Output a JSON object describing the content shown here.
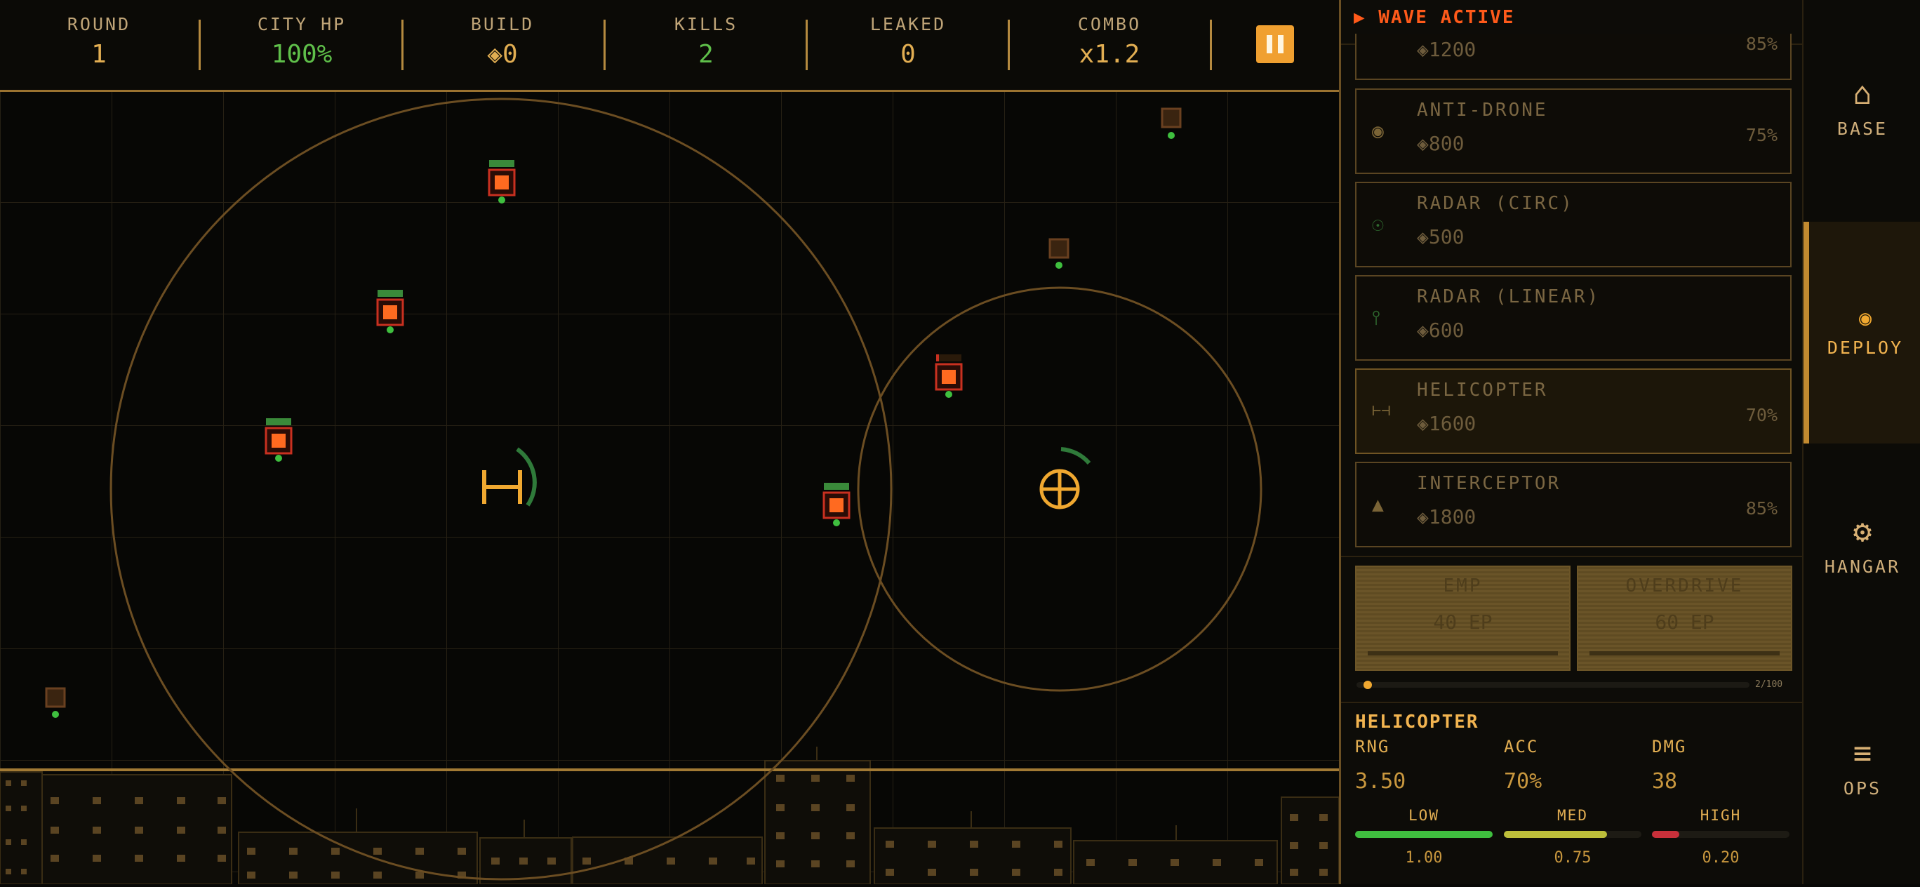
{
  "hud": {
    "stats": [
      {
        "label": "ROUND",
        "value": "1",
        "color": "#e2ae52"
      },
      {
        "label": "CITY HP",
        "value": "100%",
        "color": "#5fbf4a"
      },
      {
        "label": "BUILD",
        "value": "◈0",
        "color": "#e2ae52"
      },
      {
        "label": "KILLS",
        "value": "2",
        "color": "#5fbf4a"
      },
      {
        "label": "LEAKED",
        "value": "0",
        "color": "#e2ae52"
      },
      {
        "label": "COMBO",
        "value": "x1.2",
        "color": "#e2ae52"
      }
    ],
    "pause_icon": "pause-icon"
  },
  "panel": {
    "status": "▶ WAVE ACTIVE",
    "partial_card": {
      "cost": "◈1200",
      "pct": "85%"
    },
    "cards": [
      {
        "icon": "◉",
        "icon_name": "anti-drone-icon",
        "name": "ANTI-DRONE",
        "cost": "◈800",
        "pct": "75%"
      },
      {
        "icon": "☉",
        "icon_name": "radar-circular-icon",
        "name": "RADAR (CIRC)",
        "cost": "◈500",
        "pct": ""
      },
      {
        "icon": "⫯",
        "icon_name": "radar-linear-icon",
        "name": "RADAR (LINEAR)",
        "cost": "◈600",
        "pct": ""
      },
      {
        "icon": "⊢⊣",
        "icon_name": "helicopter-icon",
        "name": "HELICOPTER",
        "cost": "◈1600",
        "pct": "70%"
      },
      {
        "icon": "▲",
        "icon_name": "interceptor-icon",
        "name": "INTERCEPTOR",
        "cost": "◈1800",
        "pct": "85%"
      }
    ],
    "abilities": [
      {
        "name": "EMP",
        "cost": "40 EP"
      },
      {
        "name": "OVERDRIVE",
        "cost": "60 EP"
      }
    ],
    "energy": {
      "label": "2/100",
      "fraction": 0.02
    },
    "selected": {
      "title": "HELICOPTER",
      "rng_label": "RNG",
      "rng": "3.50",
      "acc_label": "ACC",
      "acc": "70%",
      "dmg_label": "DMG",
      "dmg": "38",
      "eff": [
        {
          "label": "LOW",
          "value": "1.00",
          "fraction": 1.0,
          "color": "#3fbf3f"
        },
        {
          "label": "MED",
          "value": "0.75",
          "fraction": 0.75,
          "color": "#bdbf3a"
        },
        {
          "label": "HIGH",
          "value": "0.20",
          "fraction": 0.2,
          "color": "#c8303a"
        }
      ]
    }
  },
  "nav": [
    {
      "icon": "⌂",
      "icon_name": "home-icon",
      "label": "BASE",
      "active": false
    },
    {
      "icon": "◉",
      "icon_name": "deploy-icon",
      "label": "DEPLOY",
      "active": true
    },
    {
      "icon": "⚙",
      "icon_name": "gear-icon",
      "label": "HANGAR",
      "active": false
    },
    {
      "icon": "≡",
      "icon_name": "menu-icon",
      "label": "OPS",
      "active": false
    }
  ]
}
